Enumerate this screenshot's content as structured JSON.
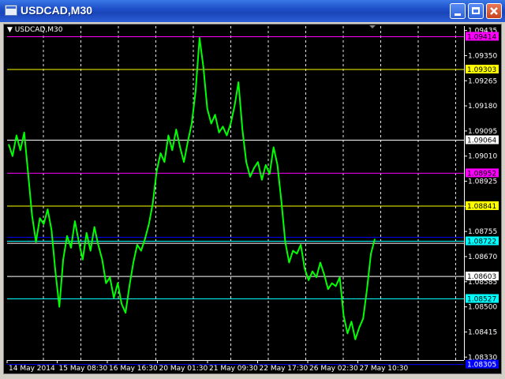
{
  "window": {
    "title": "USDCAD,M30",
    "symbol_label": "USDCAD,M30"
  },
  "chart_data": {
    "type": "line",
    "symbol": "USDCAD",
    "timeframe": "M30",
    "series": [
      {
        "color": "#00ff00",
        "values": [
          1.0905,
          1.0901,
          1.0908,
          1.0903,
          1.0909,
          1.0895,
          1.0881,
          1.0872,
          1.088,
          1.0878,
          1.0883,
          1.0876,
          1.0862,
          1.085,
          1.0866,
          1.0874,
          1.087,
          1.0879,
          1.0872,
          1.0866,
          1.0875,
          1.0869,
          1.0877,
          1.0871,
          1.0866,
          1.0858,
          1.086,
          1.0853,
          1.0858,
          1.0851,
          1.0848,
          1.0857,
          1.0865,
          1.0871,
          1.0869,
          1.0873,
          1.0878,
          1.0885,
          1.0896,
          1.0902,
          1.0899,
          1.0908,
          1.0903,
          1.091,
          1.0904,
          1.0899,
          1.0906,
          1.0912,
          1.0923,
          1.0941,
          1.0931,
          1.0917,
          1.0912,
          1.0915,
          1.0909,
          1.0911,
          1.0908,
          1.0912,
          1.0918,
          1.0926,
          1.091,
          1.0899,
          1.0894,
          1.0897,
          1.0899,
          1.0893,
          1.0898,
          1.0895,
          1.0904,
          1.0898,
          1.0886,
          1.0872,
          1.0865,
          1.0869,
          1.0868,
          1.0871,
          1.0863,
          1.0859,
          1.0862,
          1.086,
          1.0865,
          1.0861,
          1.0856,
          1.0858,
          1.0857,
          1.086,
          1.0847,
          1.0841,
          1.0845,
          1.0839,
          1.0843,
          1.0846,
          1.0856,
          1.0868,
          1.0873
        ]
      }
    ],
    "y_ticks": [
      "1.09435",
      "1.09350",
      "1.09265",
      "1.09180",
      "1.09095",
      "1.09010",
      "1.08925",
      "1.08840",
      "1.08755",
      "1.08670",
      "1.08585",
      "1.08500",
      "1.08415",
      "1.08330"
    ],
    "ylim": [
      1.0832,
      1.0945
    ],
    "x_ticks": [
      "14 May 2014",
      "15 May 08:30",
      "16 May 16:30",
      "20 May 01:30",
      "21 May 09:30",
      "22 May 17:30",
      "26 May 02:30",
      "27 May 10:30"
    ],
    "levels": [
      {
        "label": "1.09414",
        "value": 1.09414,
        "line_color": "#ff00ff",
        "label_bg": "#ff00ff",
        "label_fg": "#000000"
      },
      {
        "label": "1.09303",
        "value": 1.09303,
        "line_color": "#ffff00",
        "label_bg": "#ffff00",
        "label_fg": "#000000"
      },
      {
        "label": "1.09064",
        "value": 1.09064,
        "line_color": "#ffffff",
        "label_bg": "#ffffff",
        "label_fg": "#000000"
      },
      {
        "label": "1.08952",
        "value": 1.08952,
        "line_color": "#ff00ff",
        "label_bg": "#ff00ff",
        "label_fg": "#000000"
      },
      {
        "label": "1.08841",
        "value": 1.08841,
        "line_color": "#ffff00",
        "label_bg": "#ffff00",
        "label_fg": "#000000"
      },
      {
        "label": "1.08722",
        "value": 1.08722,
        "line_color": "#00ffff",
        "label_bg": "#00ffff",
        "label_fg": "#000000"
      },
      {
        "label": "1.08603",
        "value": 1.08603,
        "line_color": "#ffffff",
        "label_bg": "#ffffff",
        "label_fg": "#000000"
      },
      {
        "label": "1.08527",
        "value": 1.08527,
        "line_color": "#00ffff",
        "label_bg": "#00ffff",
        "label_fg": "#000000"
      },
      {
        "label": "1.08305",
        "value": 1.08305,
        "line_color": "#0000ff",
        "label_bg": "#0000ff",
        "label_fg": "#ffffff"
      }
    ],
    "extra_lines": [
      {
        "value": 1.08735,
        "color": "#0000ff"
      },
      {
        "value": 1.08715,
        "color": "#ffffff"
      }
    ],
    "grid": true,
    "grid_color": "#ffffff",
    "background": "#000000",
    "axis_color": "#ffffff"
  }
}
